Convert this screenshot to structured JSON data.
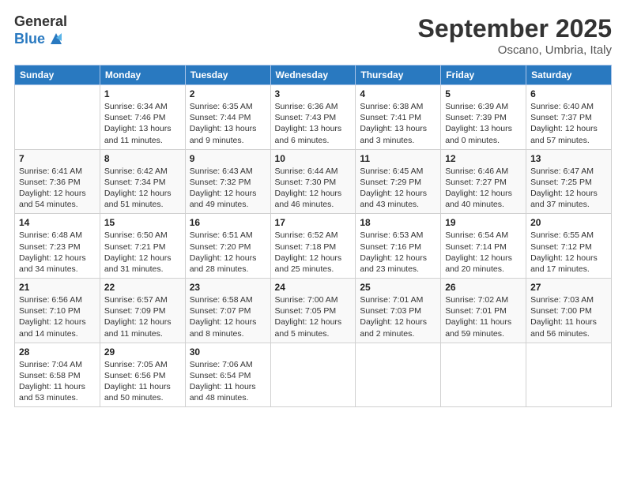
{
  "logo": {
    "general": "General",
    "blue": "Blue"
  },
  "title": "September 2025",
  "location": "Oscano, Umbria, Italy",
  "days_of_week": [
    "Sunday",
    "Monday",
    "Tuesday",
    "Wednesday",
    "Thursday",
    "Friday",
    "Saturday"
  ],
  "weeks": [
    [
      {
        "day": "",
        "sunrise": "",
        "sunset": "",
        "daylight": ""
      },
      {
        "day": "1",
        "sunrise": "Sunrise: 6:34 AM",
        "sunset": "Sunset: 7:46 PM",
        "daylight": "Daylight: 13 hours and 11 minutes."
      },
      {
        "day": "2",
        "sunrise": "Sunrise: 6:35 AM",
        "sunset": "Sunset: 7:44 PM",
        "daylight": "Daylight: 13 hours and 9 minutes."
      },
      {
        "day": "3",
        "sunrise": "Sunrise: 6:36 AM",
        "sunset": "Sunset: 7:43 PM",
        "daylight": "Daylight: 13 hours and 6 minutes."
      },
      {
        "day": "4",
        "sunrise": "Sunrise: 6:38 AM",
        "sunset": "Sunset: 7:41 PM",
        "daylight": "Daylight: 13 hours and 3 minutes."
      },
      {
        "day": "5",
        "sunrise": "Sunrise: 6:39 AM",
        "sunset": "Sunset: 7:39 PM",
        "daylight": "Daylight: 13 hours and 0 minutes."
      },
      {
        "day": "6",
        "sunrise": "Sunrise: 6:40 AM",
        "sunset": "Sunset: 7:37 PM",
        "daylight": "Daylight: 12 hours and 57 minutes."
      }
    ],
    [
      {
        "day": "7",
        "sunrise": "Sunrise: 6:41 AM",
        "sunset": "Sunset: 7:36 PM",
        "daylight": "Daylight: 12 hours and 54 minutes."
      },
      {
        "day": "8",
        "sunrise": "Sunrise: 6:42 AM",
        "sunset": "Sunset: 7:34 PM",
        "daylight": "Daylight: 12 hours and 51 minutes."
      },
      {
        "day": "9",
        "sunrise": "Sunrise: 6:43 AM",
        "sunset": "Sunset: 7:32 PM",
        "daylight": "Daylight: 12 hours and 49 minutes."
      },
      {
        "day": "10",
        "sunrise": "Sunrise: 6:44 AM",
        "sunset": "Sunset: 7:30 PM",
        "daylight": "Daylight: 12 hours and 46 minutes."
      },
      {
        "day": "11",
        "sunrise": "Sunrise: 6:45 AM",
        "sunset": "Sunset: 7:29 PM",
        "daylight": "Daylight: 12 hours and 43 minutes."
      },
      {
        "day": "12",
        "sunrise": "Sunrise: 6:46 AM",
        "sunset": "Sunset: 7:27 PM",
        "daylight": "Daylight: 12 hours and 40 minutes."
      },
      {
        "day": "13",
        "sunrise": "Sunrise: 6:47 AM",
        "sunset": "Sunset: 7:25 PM",
        "daylight": "Daylight: 12 hours and 37 minutes."
      }
    ],
    [
      {
        "day": "14",
        "sunrise": "Sunrise: 6:48 AM",
        "sunset": "Sunset: 7:23 PM",
        "daylight": "Daylight: 12 hours and 34 minutes."
      },
      {
        "day": "15",
        "sunrise": "Sunrise: 6:50 AM",
        "sunset": "Sunset: 7:21 PM",
        "daylight": "Daylight: 12 hours and 31 minutes."
      },
      {
        "day": "16",
        "sunrise": "Sunrise: 6:51 AM",
        "sunset": "Sunset: 7:20 PM",
        "daylight": "Daylight: 12 hours and 28 minutes."
      },
      {
        "day": "17",
        "sunrise": "Sunrise: 6:52 AM",
        "sunset": "Sunset: 7:18 PM",
        "daylight": "Daylight: 12 hours and 25 minutes."
      },
      {
        "day": "18",
        "sunrise": "Sunrise: 6:53 AM",
        "sunset": "Sunset: 7:16 PM",
        "daylight": "Daylight: 12 hours and 23 minutes."
      },
      {
        "day": "19",
        "sunrise": "Sunrise: 6:54 AM",
        "sunset": "Sunset: 7:14 PM",
        "daylight": "Daylight: 12 hours and 20 minutes."
      },
      {
        "day": "20",
        "sunrise": "Sunrise: 6:55 AM",
        "sunset": "Sunset: 7:12 PM",
        "daylight": "Daylight: 12 hours and 17 minutes."
      }
    ],
    [
      {
        "day": "21",
        "sunrise": "Sunrise: 6:56 AM",
        "sunset": "Sunset: 7:10 PM",
        "daylight": "Daylight: 12 hours and 14 minutes."
      },
      {
        "day": "22",
        "sunrise": "Sunrise: 6:57 AM",
        "sunset": "Sunset: 7:09 PM",
        "daylight": "Daylight: 12 hours and 11 minutes."
      },
      {
        "day": "23",
        "sunrise": "Sunrise: 6:58 AM",
        "sunset": "Sunset: 7:07 PM",
        "daylight": "Daylight: 12 hours and 8 minutes."
      },
      {
        "day": "24",
        "sunrise": "Sunrise: 7:00 AM",
        "sunset": "Sunset: 7:05 PM",
        "daylight": "Daylight: 12 hours and 5 minutes."
      },
      {
        "day": "25",
        "sunrise": "Sunrise: 7:01 AM",
        "sunset": "Sunset: 7:03 PM",
        "daylight": "Daylight: 12 hours and 2 minutes."
      },
      {
        "day": "26",
        "sunrise": "Sunrise: 7:02 AM",
        "sunset": "Sunset: 7:01 PM",
        "daylight": "Daylight: 11 hours and 59 minutes."
      },
      {
        "day": "27",
        "sunrise": "Sunrise: 7:03 AM",
        "sunset": "Sunset: 7:00 PM",
        "daylight": "Daylight: 11 hours and 56 minutes."
      }
    ],
    [
      {
        "day": "28",
        "sunrise": "Sunrise: 7:04 AM",
        "sunset": "Sunset: 6:58 PM",
        "daylight": "Daylight: 11 hours and 53 minutes."
      },
      {
        "day": "29",
        "sunrise": "Sunrise: 7:05 AM",
        "sunset": "Sunset: 6:56 PM",
        "daylight": "Daylight: 11 hours and 50 minutes."
      },
      {
        "day": "30",
        "sunrise": "Sunrise: 7:06 AM",
        "sunset": "Sunset: 6:54 PM",
        "daylight": "Daylight: 11 hours and 48 minutes."
      },
      {
        "day": "",
        "sunrise": "",
        "sunset": "",
        "daylight": ""
      },
      {
        "day": "",
        "sunrise": "",
        "sunset": "",
        "daylight": ""
      },
      {
        "day": "",
        "sunrise": "",
        "sunset": "",
        "daylight": ""
      },
      {
        "day": "",
        "sunrise": "",
        "sunset": "",
        "daylight": ""
      }
    ]
  ]
}
